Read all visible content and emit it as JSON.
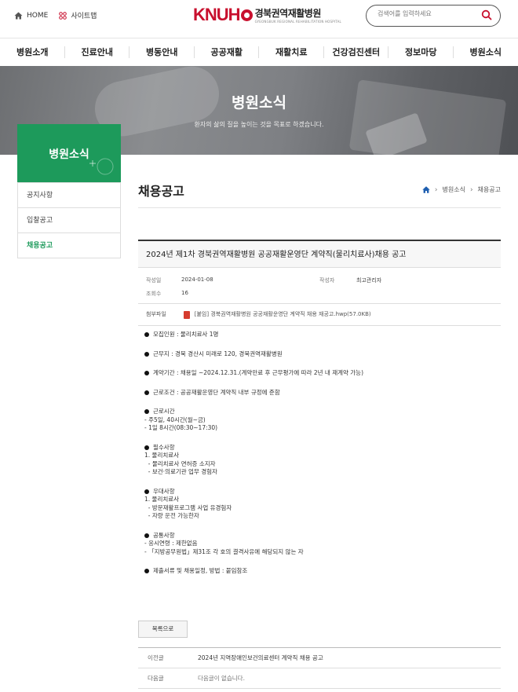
{
  "header": {
    "home_label": "HOME",
    "sitemap_label": "사이트맵",
    "logo_mark": "KNUH",
    "logo_name": "경북권역재활병원",
    "logo_sub": "GYEONGBUK REGIONAL REHABILITATION HOSPITAL",
    "search_placeholder": "검색어를 입력하세요"
  },
  "gnb": [
    "병원소개",
    "진료안내",
    "병동안내",
    "공공재활",
    "재활치료",
    "건강검진센터",
    "정보마당",
    "병원소식"
  ],
  "banner": {
    "title": "병원소식",
    "subtitle": "환자의 삶의 질을 높이는 것을 목표로 하겠습니다."
  },
  "sidebar": {
    "title": "병원소식",
    "items": [
      "공지사항",
      "입찰공고",
      "채용공고"
    ],
    "active": "채용공고"
  },
  "page": {
    "title": "채용공고",
    "breadcrumb": [
      "병원소식",
      "채용공고"
    ]
  },
  "post": {
    "title": "2024년 제1차 경북권역재활병원 공공재활운영단 계약직(물리치료사)채용 공고",
    "date_label": "작성일",
    "date": "2024-01-08",
    "author_label": "작성자",
    "author": "최고관리자",
    "views_label": "조회수",
    "views": "16",
    "attach_label": "첨부파일",
    "attach_file": "[붙임] 경북권역재활병원 공공재활운영단 계약직 채용 재공고.hwp(57.0KB)",
    "body": {
      "recruit": "모집인원 : 물리치료사 1명",
      "location": "근무지 : 경북 경산시 미래로 120, 경북권역재활병원",
      "period": "계약기간 : 채용일 ~2024.12.31.(계약만료 후 근무평가에 따라 2년 내 재계약 가능)",
      "condition": "근로조건 : 공공재활운영단 계약직 내부 규정에 준함",
      "hours_title": "근로시간",
      "hours_1": "- 주5일, 40시간(월~금)",
      "hours_2": "- 1일 8시간(08:30~17:30)",
      "req_title": "필수사항",
      "req_1": "1. 물리치료사",
      "req_2": "  - 물리치료사 면허증 소지자",
      "req_3": "  - 보건·의료기관 업무 경험자",
      "pref_title": "우대사항",
      "pref_1": "1. 물리치료사",
      "pref_2": "  - 방문재활프로그램 사업 유경험자",
      "pref_3": "  - 자량 운전 가능한자",
      "common_title": "공통사항",
      "common_1": "- 응시연령 : 제한없음",
      "common_2": "- 「지방공무원법」제31조 각 호의 결격사유에 해당되지 않는 자",
      "docs": "제출서류 및 채용일정, 방법 : 붙임참조"
    }
  },
  "list_button": "목록으로",
  "nav": {
    "prev_label": "이전글",
    "prev_title": "2024년 지역장애인보건의료센터 계약직 채용 공고",
    "next_label": "다음글",
    "next_title": "다음글이 없습니다."
  },
  "colors": {
    "brand_red": "#c8102e",
    "accent_green": "#1d9a5b"
  }
}
